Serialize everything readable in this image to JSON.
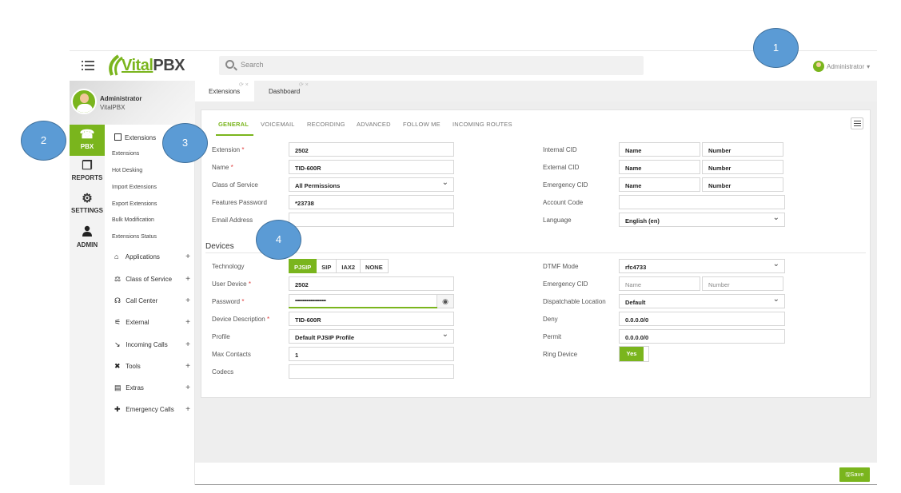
{
  "topbar": {
    "logo_text_vital": "Vital",
    "logo_text_pbx": "PBX",
    "search_placeholder": "Search",
    "user_menu_label": "Administrator",
    "user_menu_caret": "▾"
  },
  "profile": {
    "name": "Administrator",
    "org": "VitalPBX"
  },
  "sidebar": {
    "items": [
      {
        "label": "PBX",
        "icon": "phone-icon",
        "glyph": "☎",
        "active": true
      },
      {
        "label": "REPORTS",
        "icon": "copy-icon",
        "glyph": "❐",
        "active": false
      },
      {
        "label": "SETTINGS",
        "icon": "gears-icon",
        "glyph": "⚙",
        "active": false
      },
      {
        "label": "ADMIN",
        "icon": "user-icon",
        "glyph": "👤",
        "active": false
      }
    ]
  },
  "submenu": {
    "header": "Extensions",
    "links": [
      "Extensions",
      "Hot Desking",
      "Import Extensions",
      "Export Extensions",
      "Bulk Modification",
      "Extensions Status"
    ],
    "groups": [
      {
        "label": "Applications",
        "glyph": "⌂",
        "plus": "+"
      },
      {
        "label": "Class of Service",
        "glyph": "⚖",
        "plus": "+"
      },
      {
        "label": "Call Center",
        "glyph": "☊",
        "plus": "+"
      },
      {
        "label": "External",
        "glyph": "⚟",
        "plus": "+"
      },
      {
        "label": "Incoming Calls",
        "glyph": "↘",
        "plus": "+"
      },
      {
        "label": "Tools",
        "glyph": "✖",
        "plus": "+"
      },
      {
        "label": "Extras",
        "glyph": "▤",
        "plus": "+"
      },
      {
        "label": "Emergency Calls",
        "glyph": "✚",
        "plus": "+"
      }
    ]
  },
  "tabs": [
    {
      "label": "Extensions",
      "active": true
    },
    {
      "label": "Dashboard",
      "active": false
    }
  ],
  "tab_controls": "⟳ ×",
  "form_tabs": [
    "GENERAL",
    "VOICEMAIL",
    "RECORDING",
    "ADVANCED",
    "FOLLOW ME",
    "INCOMING ROUTES"
  ],
  "general": {
    "extension_label": "Extension",
    "extension_value": "2502",
    "name_label": "Name",
    "name_value": "TID-600R",
    "cos_label": "Class of Service",
    "cos_value": "All Permissions",
    "features_password_label": "Features Password",
    "features_password_value": "*23738",
    "email_label": "Email Address",
    "email_value": "",
    "internal_cid_label": "Internal CID",
    "external_cid_label": "External CID",
    "emergency_cid_label": "Emergency CID",
    "cid_name_placeholder": "Name",
    "cid_number_placeholder": "Number",
    "account_code_label": "Account Code",
    "account_code_value": "",
    "language_label": "Language",
    "language_value": "English (en)",
    "required_mark": "*"
  },
  "devices": {
    "title": "Devices",
    "technology_label": "Technology",
    "technology_options": [
      "PJSIP",
      "SIP",
      "IAX2",
      "NONE"
    ],
    "technology_selected": "PJSIP",
    "user_device_label": "User Device",
    "user_device_value": "2502",
    "password_label": "Password",
    "password_value": "••••••••••••••••••••••••",
    "device_description_label": "Device Description",
    "device_description_value": "TID-600R",
    "profile_label": "Profile",
    "profile_value": "Default PJSIP Profile",
    "max_contacts_label": "Max Contacts",
    "max_contacts_value": "1",
    "codecs_label": "Codecs",
    "codecs_value": "",
    "dtmf_label": "DTMF Mode",
    "dtmf_value": "rfc4733",
    "emergency_cid_label": "Emergency CID",
    "name_placeholder": "Name",
    "number_placeholder": "Number",
    "dispatchable_label": "Dispatchable Location",
    "dispatchable_value": "Default",
    "deny_label": "Deny",
    "deny_value": "0.0.0.0/0",
    "permit_label": "Permit",
    "permit_value": "0.0.0.0/0",
    "ring_device_label": "Ring Device",
    "ring_device_value": "Yes"
  },
  "footer": {
    "save_label": "Save",
    "save_glyph": "🖫"
  },
  "callouts": [
    "1",
    "2",
    "3",
    "4"
  ],
  "colors": {
    "accent": "#7ab51d",
    "callout": "#5b9bd5"
  }
}
